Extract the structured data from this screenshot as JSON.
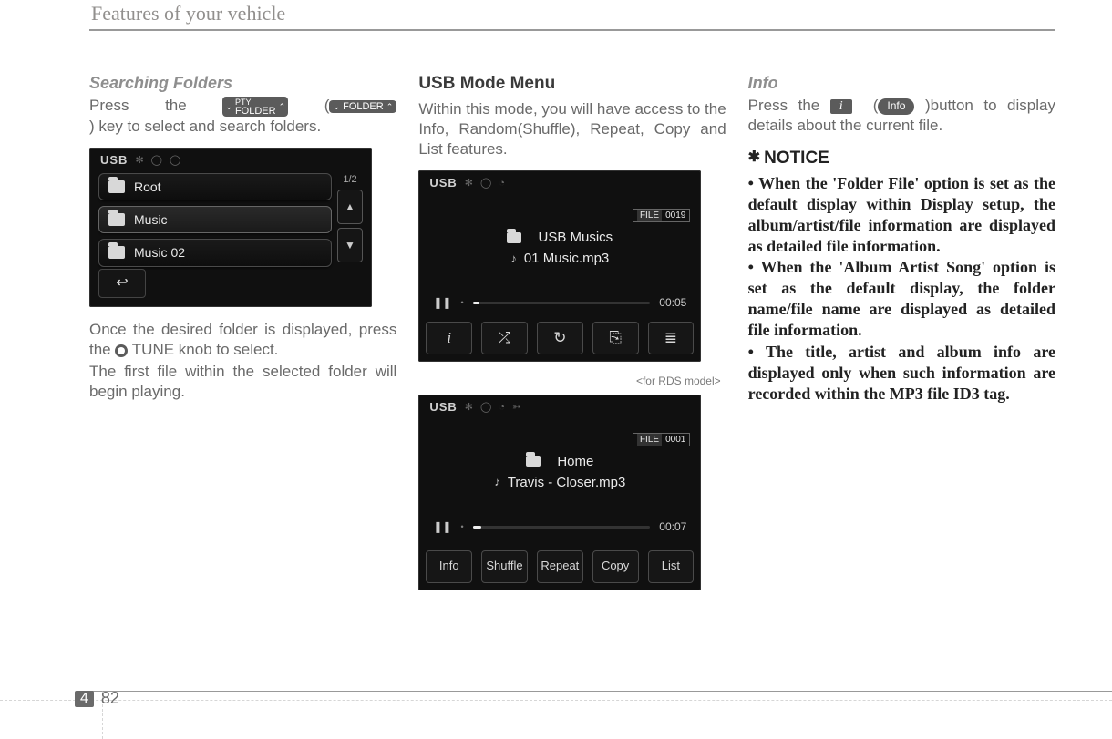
{
  "header": {
    "title": "Features of your vehicle"
  },
  "footer": {
    "section": "4",
    "page": "82"
  },
  "col1": {
    "heading": "Searching Folders",
    "p1_pre": "Press  the ",
    "pty_top": "PTY",
    "pty_bottom": "FOLDER",
    "folder_btn": "FOLDER",
    "p1_post": ") key to select and search folders.",
    "p2_pre": "Once the desired folder is displayed, press the ",
    "p2_post": "TUNE knob to select.",
    "p3": "The first file within the selected folder will begin playing.",
    "shot": {
      "usb": "USB",
      "page": "1/2",
      "rows": [
        "Root",
        "Music",
        "Music 02"
      ]
    }
  },
  "col2": {
    "heading": "USB Mode Menu",
    "p1": "Within this mode, you will have access to the Info, Random(Shuffle), Repeat, Copy and List features.",
    "caption": "<for RDS model>",
    "shotA": {
      "usb": "USB",
      "file_label": "FILE",
      "file_no": "0019",
      "folder": "USB Musics",
      "track": "01 Music.mp3",
      "time": "00:05",
      "tabs_icons": [
        "i",
        "shuffle",
        "repeat",
        "copy",
        "list"
      ]
    },
    "shotB": {
      "usb": "USB",
      "file_label": "FILE",
      "file_no": "0001",
      "folder": "Home",
      "track": "Travis - Closer.mp3",
      "time": "00:07",
      "tabs": [
        "Info",
        "Shuffle",
        "Repeat",
        "Copy",
        "List"
      ]
    }
  },
  "col3": {
    "heading": "Info",
    "p1_pre": "Press the ",
    "btn_info": "Info",
    "p1_post": ")button to display details about the current file.",
    "notice": "NOTICE",
    "bullets": [
      "When the 'Folder File' option is set as the default display within Display setup, the album/artist/file information are displayed as detailed file information.",
      "When the 'Album Artist Song' option is set as the default display, the folder name/file name are displayed as detailed file information.",
      "The title, artist and album info are displayed only when such information are recorded within the MP3 file ID3 tag."
    ]
  }
}
